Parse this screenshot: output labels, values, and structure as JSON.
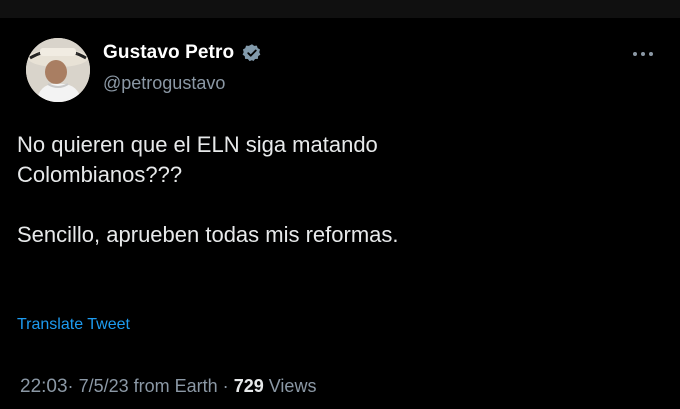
{
  "colors": {
    "background": "#000000",
    "text": "#e7e9ea",
    "muted": "#8b98a5",
    "link": "#1d9bf0",
    "verified": "#829aab"
  },
  "author": {
    "display_name": "Gustavo Petro",
    "handle": "@petrogustavo",
    "verified_icon": "verified-badge-icon",
    "avatar_icon": "avatar-photo"
  },
  "more_icon": "more-options-icon",
  "tweet": {
    "line1": "No quieren que el ELN siga matando",
    "line2": "Colombianos???",
    "line3": "Sencillo, aprueben todas mis reformas."
  },
  "translate_label": "Translate Tweet",
  "meta": {
    "time": "22:03",
    "date": "7/5/23",
    "source": "from Earth",
    "separator": "·",
    "views_count": "729",
    "views_label": "Views"
  }
}
